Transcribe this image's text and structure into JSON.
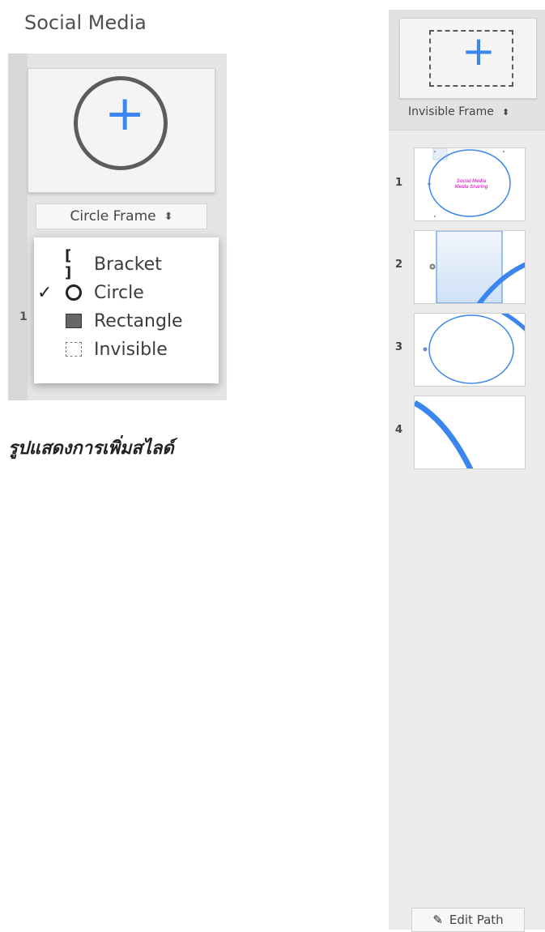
{
  "left": {
    "title": "Social Media",
    "frame_select": {
      "value": "Circle Frame",
      "arrow": "⬍"
    },
    "slide_number": "1",
    "dropdown": [
      {
        "check": "",
        "icon": "bracket-icon",
        "icon_text": "[ ]",
        "label": "Bracket"
      },
      {
        "check": "✓",
        "icon": "circle-icon",
        "icon_text": "",
        "label": "Circle"
      },
      {
        "check": "",
        "icon": "rectangle-icon",
        "icon_text": "",
        "label": "Rectangle"
      },
      {
        "check": "",
        "icon": "invisible-icon",
        "icon_text": "",
        "label": "Invisible"
      }
    ]
  },
  "caption": "รูปแสดงการเพิ่มสไลด์",
  "right": {
    "frame_select": {
      "value": "Invisible Frame",
      "arrow": "⬍"
    },
    "slides": [
      {
        "number": "1",
        "text_line1": "Social Media",
        "text_line2": "Media Sharing"
      },
      {
        "number": "2"
      },
      {
        "number": "3"
      },
      {
        "number": "4"
      }
    ],
    "edit_path_label": "Edit Path"
  },
  "colors": {
    "accent": "#3b86ee",
    "pink_text": "#e040c8",
    "panel": "#ebebeb"
  }
}
